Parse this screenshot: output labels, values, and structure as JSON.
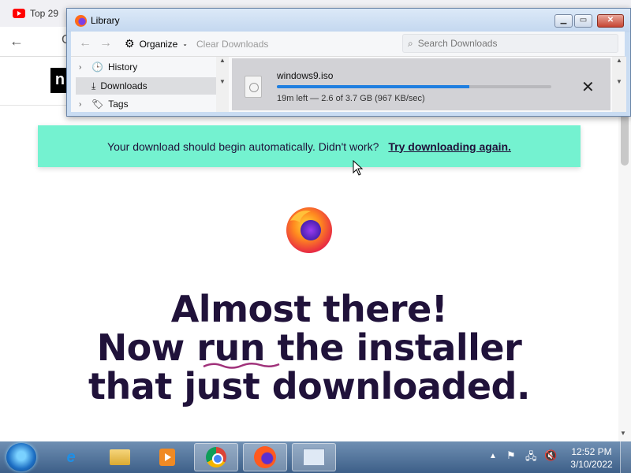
{
  "browser": {
    "tab_title": "Top 29",
    "site_logo": "n"
  },
  "banner": {
    "text": "Your download should begin automatically. Didn't work?",
    "link": "Try downloading again."
  },
  "headline": {
    "line1": "Almost there!",
    "line2": "Now run the installer",
    "line3": "that just downloaded."
  },
  "library": {
    "title": "Library",
    "organize_label": "Organize",
    "clear_label": "Clear Downloads",
    "search_placeholder": "Search Downloads",
    "sidebar": [
      {
        "label": "History",
        "icon": "clock-icon"
      },
      {
        "label": "Downloads",
        "icon": "download-icon"
      },
      {
        "label": "Tags",
        "icon": "tag-icon"
      }
    ],
    "download": {
      "filename": "windows9.iso",
      "status": "19m left — 2.6 of 3.7 GB (967 KB/sec)",
      "progress": 0.7
    }
  },
  "taskbar": {
    "time": "12:52 PM",
    "date": "3/10/2022",
    "apps": [
      "internet-explorer",
      "file-explorer",
      "media-player",
      "chrome",
      "firefox",
      "control-panel"
    ]
  },
  "colors": {
    "banner": "#74f2d0",
    "headline": "#20123a",
    "progress": "#1f7fe0"
  }
}
